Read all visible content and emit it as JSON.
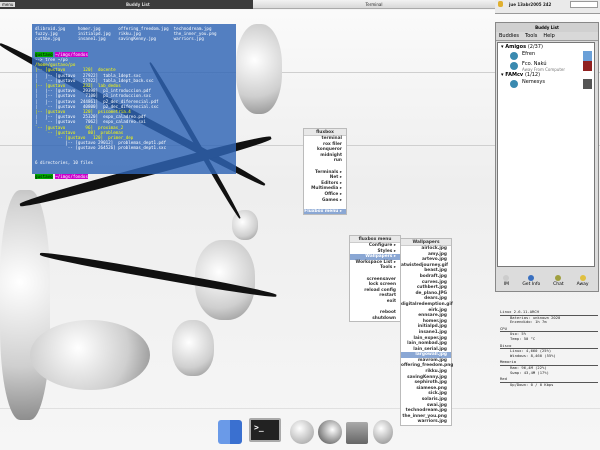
{
  "topbar": {
    "left_btn": "menu",
    "left_title": "Buddy List",
    "center_title": "Terminal",
    "clock": "jue 13abr2005 242"
  },
  "terminal": {
    "ls_lines": [
      "dlibroid.jpg     homer.jpg       offering_freedom.jpg  technodream.jpg",
      "fuzzy.jpg        initialpd.jpg   rikku.jpg             the_inner_you.png",
      "cuthbe.jpg       insane1.jpg     savingKenny.jpg       warriors.jpg"
    ],
    "prompt_user": "gustavo",
    "prompt_path": "~/imgs/fondos",
    "command": "--> tree ~/po",
    "root": "/home/gustavo/po",
    "tree_lines": [
      "|-- [gustavo       120]  docente",
      "|   |-- [gustavo   27922]  tabla_1dept.sxc",
      "|   `-- [gustavo   27922]  tabla_1dept_back.sxc",
      "|-- [gustavo       232]  lab_dedos",
      "|   |-- [gustavo   29398]  p1_introduccion.pdf",
      "|   |-- [gustavo    7100]  p1_introduccion.sxc",
      "|   |-- [gustavo  244861]  p2_dec_diferencial.pdf",
      "|   `-- [gustavo   40800]  p2_dec_diferencial.sxc",
      "|-- [gustavo       120]  psicometria.4",
      "|   |-- [gustavo   25320]  expo_caladreo.pdf",
      "|   `-- [gustavo    7062]  expo_caladreo.sxi",
      "`-- [gustavo        96]  proximas_2",
      "    `-- [gustavo     80]  problemas",
      "        `-- [gustavo   120]  primer_dep",
      "            |-- [gustavo 29012]  problemas_dept1.pdf",
      "            `-- [gustavo 264526] problemas_dept1.sxc"
    ],
    "summary": "6 directories, 10 files"
  },
  "buddy_list": {
    "title": "Buddy List",
    "menu": [
      "Buddies",
      "Tools",
      "Help"
    ],
    "groups": [
      {
        "name": "Amigos",
        "count": "(2/37)",
        "buddies": [
          {
            "name": "Efren",
            "status": ""
          },
          {
            "name": "Fco. Nakú",
            "status": "Away From Computer"
          }
        ]
      },
      {
        "name": "FAMcv",
        "count": "(1/12)",
        "buddies": [
          {
            "name": "Nemesys",
            "status": ""
          }
        ]
      }
    ],
    "toolbar": [
      "IM",
      "Get Info",
      "Chat",
      "Away"
    ]
  },
  "root_menu": {
    "title": "fluxbox",
    "items": [
      "terminal",
      "rox filer",
      "konqueror",
      "midnight",
      "run",
      "",
      "Terminals",
      "Net",
      "Editors",
      "Multimedia",
      "Office",
      "Games",
      "",
      "Fluxbox menu"
    ]
  },
  "fluxbox_menu": {
    "title": "fluxbox menu",
    "items": [
      "Configure",
      "Styles",
      "Wallpapers",
      "Workspace List",
      "Tools",
      "",
      "screensaver",
      "lock screen",
      "reload config",
      "restart",
      "exit",
      "",
      "reboot",
      "shutdown"
    ]
  },
  "wallpapers": {
    "title": "Wallpapers",
    "items": [
      "airlock.jpg",
      "amy.jpg",
      "artevo.jpg",
      "atwistedjourney.gif",
      "beast.jpg",
      "bodraft.jpg",
      "curves.jpg",
      "cuthbert.jpg",
      "de_plano.JPG",
      "dears.jpg",
      "digitalredemption.gif",
      "eirk.jpg",
      "ennsare.jpg",
      "homer.jpg",
      "initialpd.jpg",
      "insane1.jpg",
      "lain_exper.jpg",
      "lain_nombad.jpg",
      "lain_serial.jpg",
      "largowall.jpg",
      "mavrom.jpg",
      "offering_freedom.png",
      "rikku.jpg",
      "savingKenny.jpg",
      "sephiroth.jpg",
      "siamese.png",
      "sick.jpg",
      "solaris.jpg",
      "swai.jpg",
      "technodream.jpg",
      "the_inner_you.png",
      "warriors.jpg"
    ],
    "selected": "largowall.jpg"
  },
  "conky": {
    "kernel": "Linux 2.6.11-ARCH",
    "battery": "Baterias:   unknown 2020",
    "uptime": "Encendido:  1h 7m",
    "cpu_h": "CPU",
    "cpu": [
      "Uso:   5%",
      "Temp:  50 °C"
    ],
    "disk_h": "Disco",
    "disk": [
      "Linux:    4,660 (25%)",
      "Windows:  8,460 (55%)"
    ],
    "mem_h": "Memoria",
    "mem": [
      "Ram:    96,4M (22%)",
      "Swap:   43,4M (17%)"
    ],
    "net_h": "Red",
    "net": [
      "Up/Down:  0 / 0 Kbps"
    ]
  },
  "dock": [
    "finder-icon",
    "terminal-icon",
    "sphere-icon",
    "globe-icon",
    "disk-icon",
    "sphere-icon"
  ]
}
